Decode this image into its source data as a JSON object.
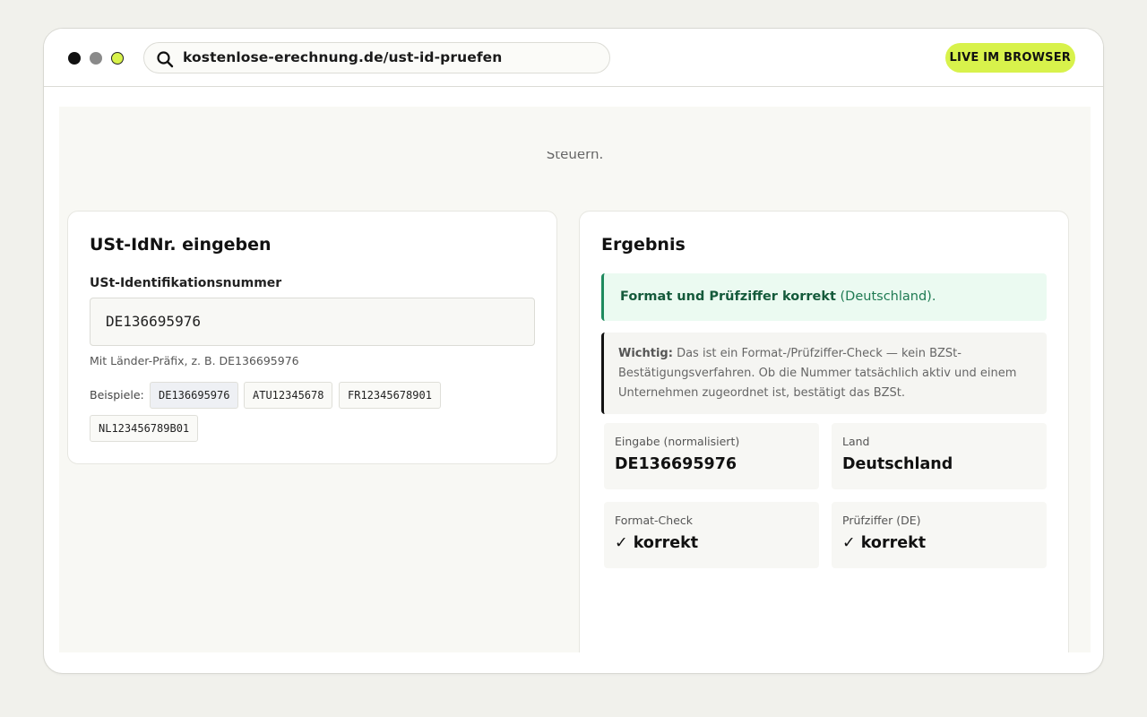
{
  "browser": {
    "url": "kostenlose-erechnung.de/ust-id-pruefen",
    "badge": "LIVE IM BROWSER"
  },
  "page": {
    "cut_text": "Steuern."
  },
  "input_card": {
    "title": "USt-IdNr. eingeben",
    "field_label": "USt-Identifikationsnummer",
    "field_value": "DE136695976",
    "hint": "Mit Länder-Präfix, z. B. DE136695976",
    "examples_label": "Beispiele:",
    "examples": [
      "DE136695976",
      "ATU12345678",
      "FR12345678901",
      "NL123456789B01"
    ]
  },
  "result_card": {
    "title": "Ergebnis",
    "ok_strong": "Format und Prüfziffer korrekt",
    "ok_rest": " (Deutschland).",
    "note_strong": "Wichtig:",
    "note_text": " Das ist ein Format-/Prüfziffer-Check — kein BZSt-Bestätigungsverfahren. Ob die Nummer tatsächlich aktiv und einem Unternehmen zugeordnet ist, bestätigt das BZSt.",
    "stats": [
      {
        "label": "Eingabe (normalisiert)",
        "value": "DE136695976"
      },
      {
        "label": "Land",
        "value": "Deutschland"
      },
      {
        "label": "Format-Check",
        "value": "✓ korrekt"
      },
      {
        "label": "Prüfziffer (DE)",
        "value": "✓ korrekt"
      }
    ]
  },
  "colors": {
    "accent": "#d8f24b",
    "success_bg": "#ebfaf1",
    "success_border": "#1e8a5e"
  }
}
